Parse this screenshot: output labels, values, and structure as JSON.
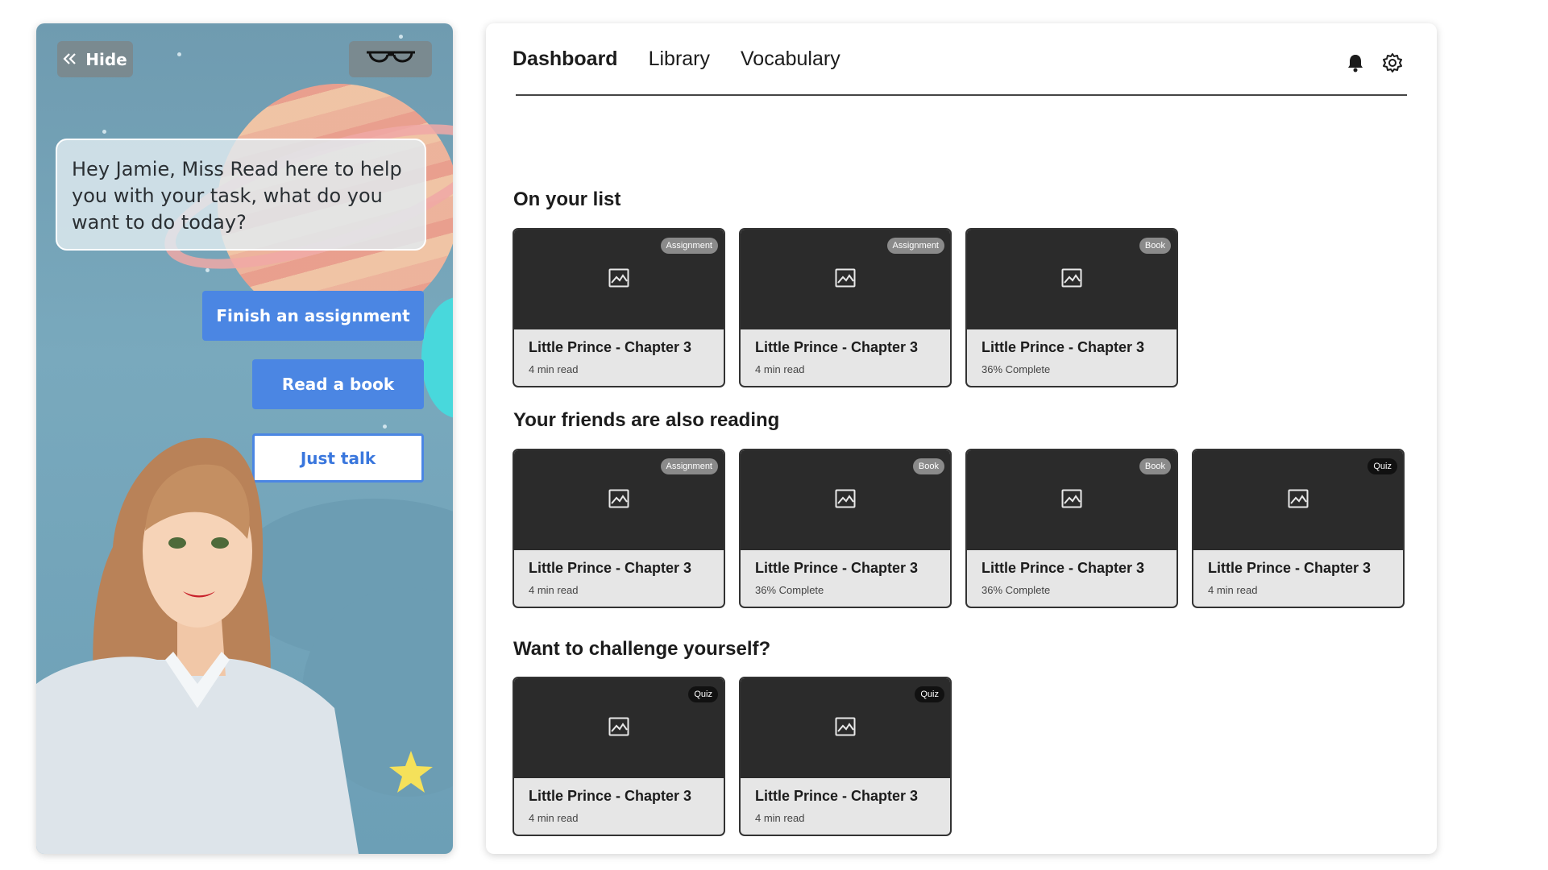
{
  "assistant": {
    "hide_label": "Hide",
    "message": "Hey Jamie, Miss Read here to help you with your task, what do you want to do today?",
    "options": [
      "Finish an assignment",
      "Read a book",
      "Just talk"
    ]
  },
  "nav": {
    "tabs": [
      "Dashboard",
      "Library",
      "Vocabulary"
    ],
    "active_tab": "Dashboard"
  },
  "sections": [
    {
      "title": "On your list",
      "cards": [
        {
          "badge": "Assignment",
          "title": "Little Prince - Chapter 3",
          "meta": "4 min read"
        },
        {
          "badge": "Assignment",
          "title": "Little Prince - Chapter 3",
          "meta": "4 min read"
        },
        {
          "badge": "Book",
          "title": "Little Prince - Chapter 3",
          "meta": "36% Complete"
        }
      ]
    },
    {
      "title": "Your friends are also reading",
      "cards": [
        {
          "badge": "Assignment",
          "title": "Little Prince - Chapter 3",
          "meta": "4 min read"
        },
        {
          "badge": "Book",
          "title": "Little Prince - Chapter 3",
          "meta": "36% Complete"
        },
        {
          "badge": "Book",
          "title": "Little Prince - Chapter 3",
          "meta": "36% Complete"
        },
        {
          "badge": "Quiz",
          "title": "Little Prince - Chapter 3",
          "meta": "4 min read"
        }
      ]
    },
    {
      "title": "Want to challenge yourself?",
      "cards": [
        {
          "badge": "Quiz",
          "title": "Little Prince - Chapter 3",
          "meta": "4 min read"
        },
        {
          "badge": "Quiz",
          "title": "Little Prince - Chapter 3",
          "meta": "4 min read"
        }
      ]
    }
  ],
  "colors": {
    "primary_button": "#4b86e3",
    "card_image": "#2b2b2b",
    "badge_default": "#8a8a8a",
    "badge_quiz": "#111111"
  }
}
